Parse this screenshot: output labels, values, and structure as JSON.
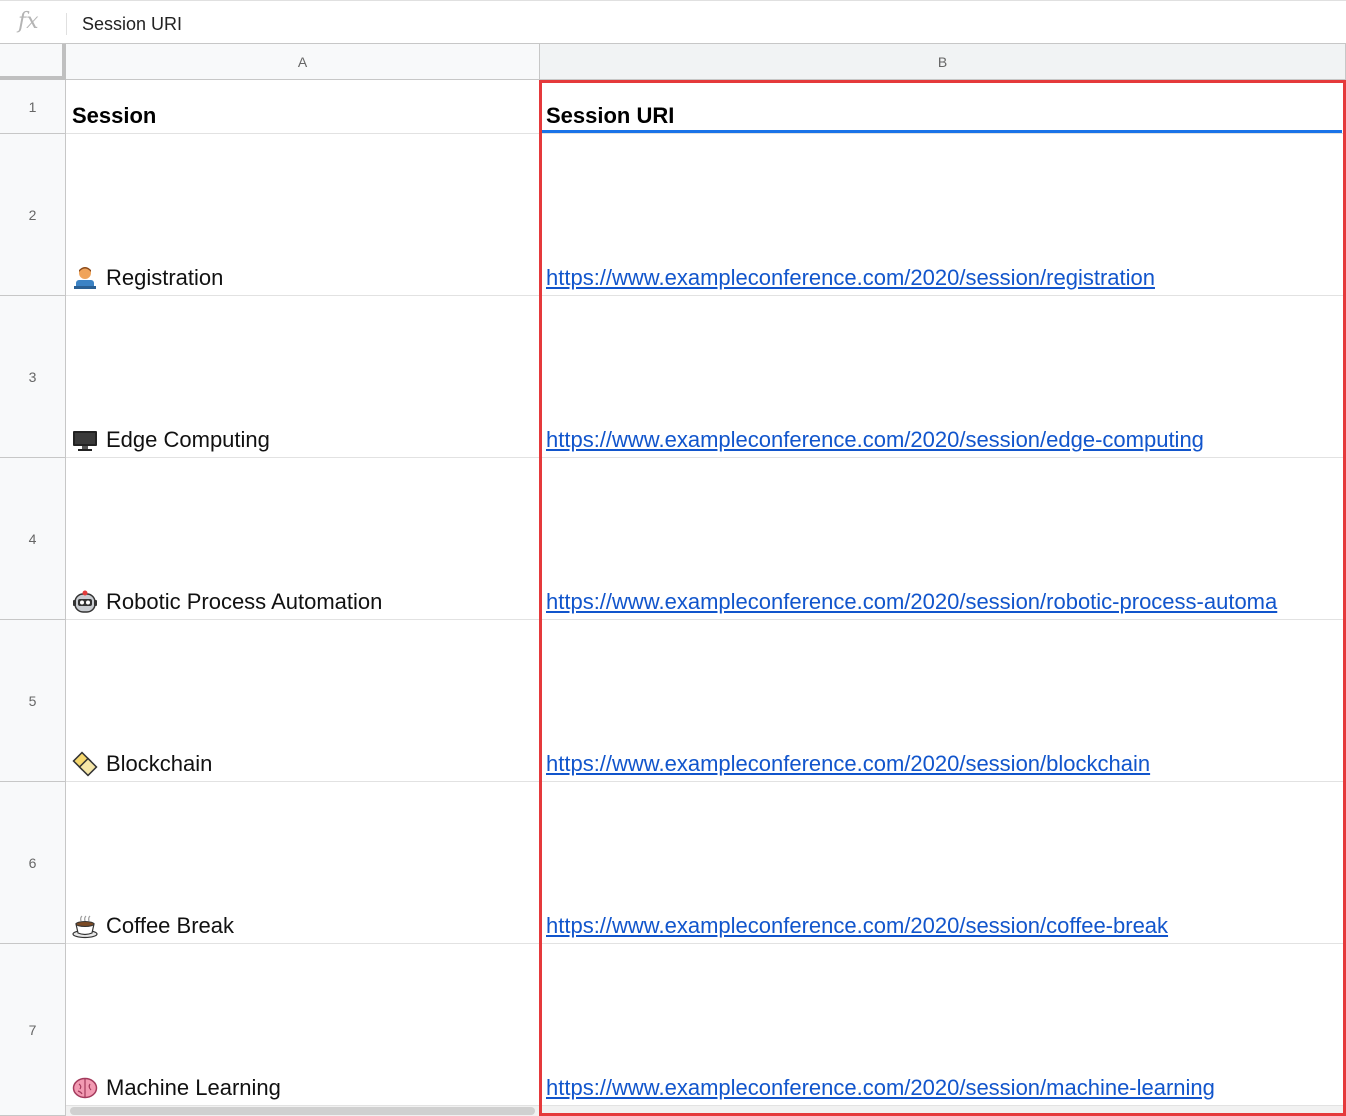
{
  "formula_bar": {
    "fx_label": "fx",
    "value": "Session URI"
  },
  "columns": [
    "A",
    "B"
  ],
  "rows": [
    {
      "number": "1",
      "session": "Session",
      "uri": "Session URI",
      "icon": ""
    },
    {
      "number": "2",
      "session": "Registration",
      "uri": "https://www.exampleconference.com/2020/session/registration",
      "icon": "person-at-desk-icon"
    },
    {
      "number": "3",
      "session": "Edge Computing",
      "uri": "https://www.exampleconference.com/2020/session/edge-computing",
      "icon": "monitor-icon"
    },
    {
      "number": "4",
      "session": "Robotic Process Automation",
      "uri": "https://www.exampleconference.com/2020/session/robotic-process-automa",
      "icon": "robot-icon"
    },
    {
      "number": "5",
      "session": "Blockchain",
      "uri": "https://www.exampleconference.com/2020/session/blockchain",
      "icon": "blockchain-icon"
    },
    {
      "number": "6",
      "session": "Coffee Break",
      "uri": "https://www.exampleconference.com/2020/session/coffee-break",
      "icon": "coffee-icon"
    },
    {
      "number": "7",
      "session": "Machine Learning",
      "uri": "https://www.exampleconference.com/2020/session/machine-learning",
      "icon": "brain-icon"
    }
  ],
  "colors": {
    "link": "#1155cc",
    "selection": "#e5393b",
    "active": "#1a73e8"
  }
}
